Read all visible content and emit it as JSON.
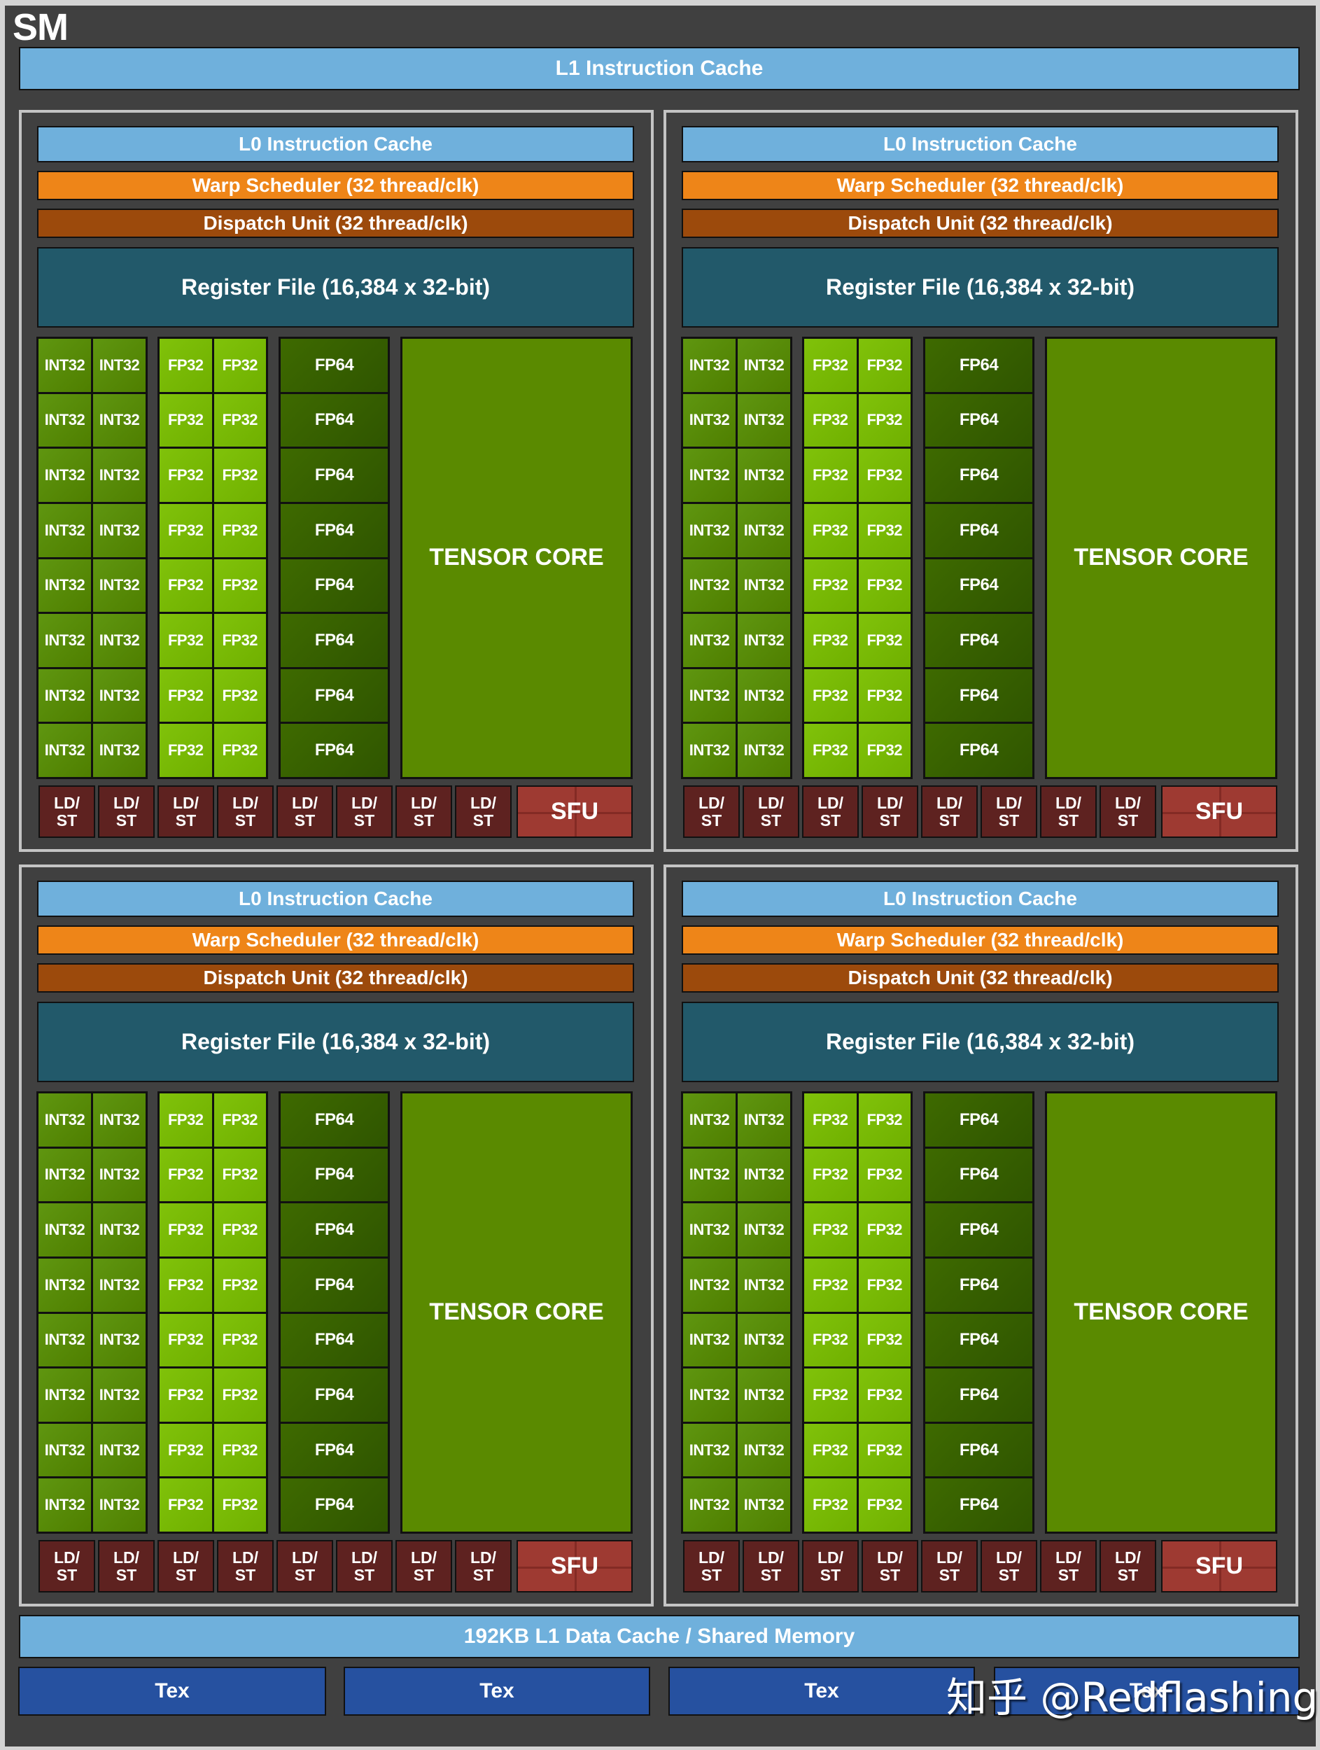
{
  "title": "SM",
  "l1_instruction_cache": "L1 Instruction Cache",
  "quadrants": [
    {
      "id": "top-left"
    },
    {
      "id": "top-right"
    },
    {
      "id": "bottom-left"
    },
    {
      "id": "bottom-right"
    }
  ],
  "quadrant": {
    "l0_cache": "L0 Instruction Cache",
    "warp_scheduler": "Warp Scheduler (32 thread/clk)",
    "dispatch_unit": "Dispatch Unit (32 thread/clk)",
    "register_file": "Register File (16,384 x 32-bit)",
    "int_label": "INT32",
    "fp32_label": "FP32",
    "fp64_label": "FP64",
    "tensor_label": "TENSOR CORE",
    "ldst_label_line1": "LD/",
    "ldst_label_line2": "ST",
    "sfu_label": "SFU",
    "unit_rows": 8,
    "ldst_count": 8
  },
  "l1_data_cache": "192KB L1 Data Cache / Shared Memory",
  "tex_units": [
    "Tex",
    "Tex",
    "Tex",
    "Tex"
  ],
  "watermark": "知乎 @Redflashing",
  "colors": {
    "background": "#404040",
    "l0_cache": "#6fb0dc",
    "warp_scheduler": "#ee8518",
    "dispatch_unit": "#9c4a0c",
    "register_file": "#22596a",
    "int32": "#578a00",
    "fp32": "#76b900",
    "fp64": "#365f00",
    "tensor_core": "#5a8a00",
    "ldst": "#5e2220",
    "sfu": "#9e3a32",
    "tex": "#2651a0"
  }
}
